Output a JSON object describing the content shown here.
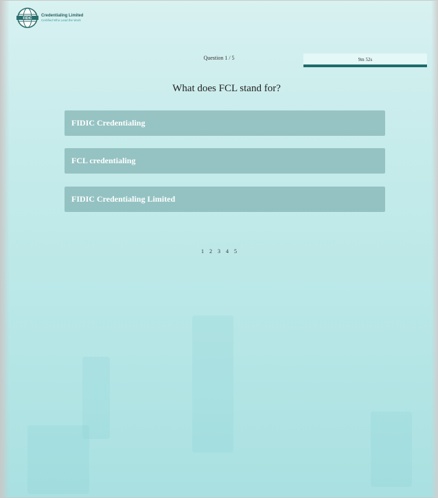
{
  "logo": {
    "name": "Credentialing Limited",
    "tagline": "Certified Who Lead the Work",
    "icon": "globe-logo-icon",
    "mark_text": "FIDIC"
  },
  "quiz": {
    "counter": "Question 1 / 5",
    "timer": "9m 52s",
    "timer_progress": 1.0,
    "question": "What does FCL stand for?",
    "options": [
      "FIDIC Credentialing",
      "FCL credentialing",
      "FIDIC Credentialing Limited"
    ],
    "pages": [
      "1",
      "2",
      "3",
      "4",
      "5"
    ]
  },
  "colors": {
    "accent": "#1e6b6b",
    "option_bg": "#78aaaa",
    "background": "#c6ebeb"
  }
}
